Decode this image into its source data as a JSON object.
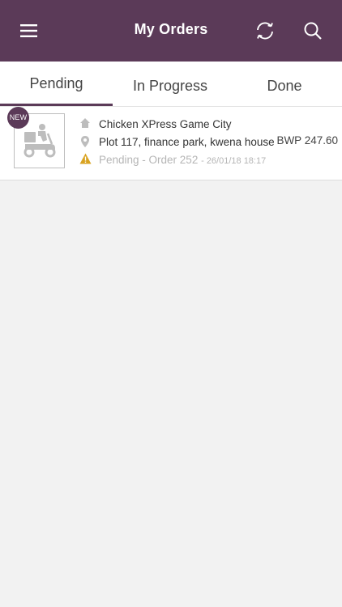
{
  "header": {
    "title": "My Orders",
    "menu_icon": "hamburger-menu-icon",
    "refresh_icon": "refresh-icon",
    "search_icon": "search-icon",
    "bg_color": "#5b3a58"
  },
  "tabs": [
    {
      "label": "Pending",
      "active": true
    },
    {
      "label": "In Progress",
      "active": false
    },
    {
      "label": "Done",
      "active": false
    }
  ],
  "orders": [
    {
      "badge": "NEW",
      "thumbnail_icon": "delivery-scooter-icon",
      "restaurant": "Chicken XPress Game City",
      "address": "Plot 117, finance park, kwena house",
      "status": "Pending - Order 252",
      "timestamp": "- 26/01/18 18:17",
      "price": "BWP 247.60",
      "status_icon": "warning-icon",
      "status_icon_color": "#d9a321"
    }
  ]
}
